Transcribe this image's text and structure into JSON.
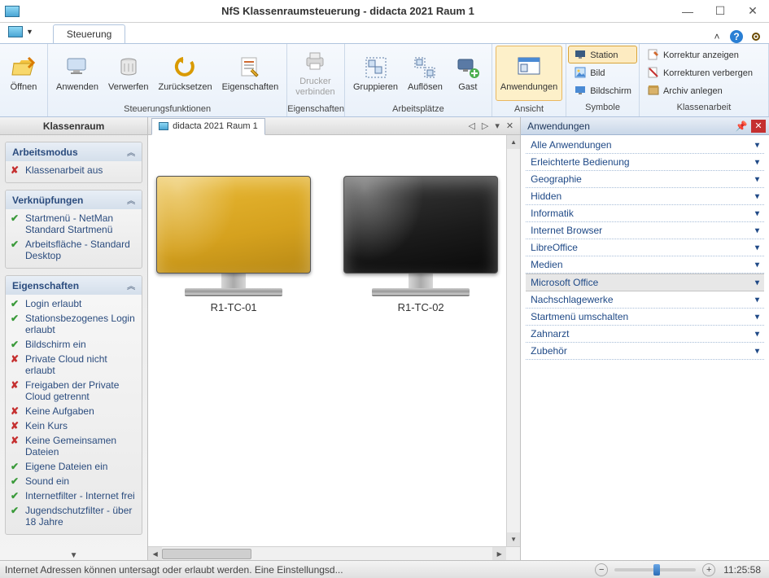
{
  "window": {
    "title": "NfS Klassenraumsteuerung - didacta 2021 Raum 1"
  },
  "tabs": {
    "main": "Steuerung"
  },
  "ribbon": {
    "open": "Öffnen",
    "apply": "Anwenden",
    "discard": "Verwerfen",
    "reset": "Zurücksetzen",
    "properties": "Eigenschaften",
    "printer_connect": "Drucker\nverbinden",
    "group": "Gruppieren",
    "ungroup": "Auflösen",
    "guest": "Gast",
    "applications": "Anwendungen",
    "station": "Station",
    "image": "Bild",
    "screen": "Bildschirm",
    "show_correction": "Korrektur anzeigen",
    "hide_corrections": "Korrekturen verbergen",
    "archive": "Archiv anlegen",
    "g_functions": "Steuerungsfunktionen",
    "g_properties": "Eigenschaften",
    "g_workstations": "Arbeitsplätze",
    "g_view": "Ansicht",
    "g_symbols": "Symbole",
    "g_classwork": "Klassenarbeit"
  },
  "left": {
    "header": "Klassenraum",
    "s1": {
      "title": "Arbeitsmodus",
      "items": [
        {
          "ok": false,
          "label": "Klassenarbeit aus"
        }
      ]
    },
    "s2": {
      "title": "Verknüpfungen",
      "items": [
        {
          "ok": true,
          "label": "Startmenü - NetMan Standard Startmenü"
        },
        {
          "ok": true,
          "label": "Arbeitsfläche - Standard Desktop"
        }
      ]
    },
    "s3": {
      "title": "Eigenschaften",
      "items": [
        {
          "ok": true,
          "label": "Login erlaubt"
        },
        {
          "ok": true,
          "label": "Stationsbezogenes Login erlaubt"
        },
        {
          "ok": true,
          "label": "Bildschirm ein"
        },
        {
          "ok": false,
          "label": "Private Cloud nicht erlaubt"
        },
        {
          "ok": false,
          "label": "Freigaben der Private Cloud getrennt"
        },
        {
          "ok": false,
          "label": "Keine Aufgaben"
        },
        {
          "ok": false,
          "label": "Kein Kurs"
        },
        {
          "ok": false,
          "label": "Keine Gemeinsamen Dateien"
        },
        {
          "ok": true,
          "label": "Eigene Dateien ein"
        },
        {
          "ok": true,
          "label": "Sound ein"
        },
        {
          "ok": true,
          "label": "Internetfilter - Internet frei"
        },
        {
          "ok": true,
          "label": "Jugendschutzfilter - über 18 Jahre"
        }
      ]
    }
  },
  "center": {
    "doc_tab": "didacta 2021 Raum 1",
    "stations": [
      {
        "name": "R1-TC-01",
        "color": "yellow"
      },
      {
        "name": "R1-TC-02",
        "color": "black"
      }
    ]
  },
  "right": {
    "header": "Anwendungen",
    "items": [
      {
        "label": "Alle Anwendungen",
        "h": false
      },
      {
        "label": "Erleichterte Bedienung",
        "h": false
      },
      {
        "label": "Geographie",
        "h": false
      },
      {
        "label": "Hidden",
        "h": false
      },
      {
        "label": "Informatik",
        "h": false
      },
      {
        "label": "Internet Browser",
        "h": false
      },
      {
        "label": "LibreOffice",
        "h": false
      },
      {
        "label": "Medien",
        "h": false
      },
      {
        "label": "Microsoft Office",
        "h": true
      },
      {
        "label": "Nachschlagewerke",
        "h": false
      },
      {
        "label": "Startmenü umschalten",
        "h": false
      },
      {
        "label": "Zahnarzt",
        "h": false
      },
      {
        "label": "Zubehör",
        "h": false
      }
    ]
  },
  "status": {
    "message": "Internet Adressen können untersagt oder erlaubt werden. Eine Einstellungsd...",
    "time": "11:25:58"
  }
}
